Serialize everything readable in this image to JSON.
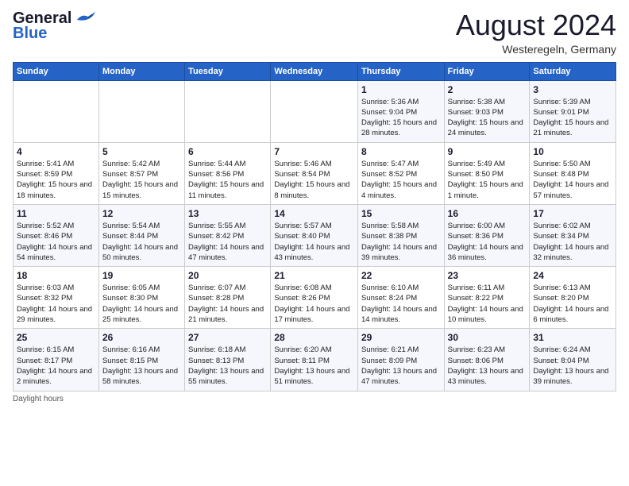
{
  "header": {
    "logo_line1": "General",
    "logo_line2": "Blue",
    "month": "August 2024",
    "location": "Westeregeln, Germany"
  },
  "days_of_week": [
    "Sunday",
    "Monday",
    "Tuesday",
    "Wednesday",
    "Thursday",
    "Friday",
    "Saturday"
  ],
  "weeks": [
    [
      {
        "num": "",
        "sunrise": "",
        "sunset": "",
        "daylight": ""
      },
      {
        "num": "",
        "sunrise": "",
        "sunset": "",
        "daylight": ""
      },
      {
        "num": "",
        "sunrise": "",
        "sunset": "",
        "daylight": ""
      },
      {
        "num": "",
        "sunrise": "",
        "sunset": "",
        "daylight": ""
      },
      {
        "num": "1",
        "sunrise": "Sunrise: 5:36 AM",
        "sunset": "Sunset: 9:04 PM",
        "daylight": "Daylight: 15 hours and 28 minutes."
      },
      {
        "num": "2",
        "sunrise": "Sunrise: 5:38 AM",
        "sunset": "Sunset: 9:03 PM",
        "daylight": "Daylight: 15 hours and 24 minutes."
      },
      {
        "num": "3",
        "sunrise": "Sunrise: 5:39 AM",
        "sunset": "Sunset: 9:01 PM",
        "daylight": "Daylight: 15 hours and 21 minutes."
      }
    ],
    [
      {
        "num": "4",
        "sunrise": "Sunrise: 5:41 AM",
        "sunset": "Sunset: 8:59 PM",
        "daylight": "Daylight: 15 hours and 18 minutes."
      },
      {
        "num": "5",
        "sunrise": "Sunrise: 5:42 AM",
        "sunset": "Sunset: 8:57 PM",
        "daylight": "Daylight: 15 hours and 15 minutes."
      },
      {
        "num": "6",
        "sunrise": "Sunrise: 5:44 AM",
        "sunset": "Sunset: 8:56 PM",
        "daylight": "Daylight: 15 hours and 11 minutes."
      },
      {
        "num": "7",
        "sunrise": "Sunrise: 5:46 AM",
        "sunset": "Sunset: 8:54 PM",
        "daylight": "Daylight: 15 hours and 8 minutes."
      },
      {
        "num": "8",
        "sunrise": "Sunrise: 5:47 AM",
        "sunset": "Sunset: 8:52 PM",
        "daylight": "Daylight: 15 hours and 4 minutes."
      },
      {
        "num": "9",
        "sunrise": "Sunrise: 5:49 AM",
        "sunset": "Sunset: 8:50 PM",
        "daylight": "Daylight: 15 hours and 1 minute."
      },
      {
        "num": "10",
        "sunrise": "Sunrise: 5:50 AM",
        "sunset": "Sunset: 8:48 PM",
        "daylight": "Daylight: 14 hours and 57 minutes."
      }
    ],
    [
      {
        "num": "11",
        "sunrise": "Sunrise: 5:52 AM",
        "sunset": "Sunset: 8:46 PM",
        "daylight": "Daylight: 14 hours and 54 minutes."
      },
      {
        "num": "12",
        "sunrise": "Sunrise: 5:54 AM",
        "sunset": "Sunset: 8:44 PM",
        "daylight": "Daylight: 14 hours and 50 minutes."
      },
      {
        "num": "13",
        "sunrise": "Sunrise: 5:55 AM",
        "sunset": "Sunset: 8:42 PM",
        "daylight": "Daylight: 14 hours and 47 minutes."
      },
      {
        "num": "14",
        "sunrise": "Sunrise: 5:57 AM",
        "sunset": "Sunset: 8:40 PM",
        "daylight": "Daylight: 14 hours and 43 minutes."
      },
      {
        "num": "15",
        "sunrise": "Sunrise: 5:58 AM",
        "sunset": "Sunset: 8:38 PM",
        "daylight": "Daylight: 14 hours and 39 minutes."
      },
      {
        "num": "16",
        "sunrise": "Sunrise: 6:00 AM",
        "sunset": "Sunset: 8:36 PM",
        "daylight": "Daylight: 14 hours and 36 minutes."
      },
      {
        "num": "17",
        "sunrise": "Sunrise: 6:02 AM",
        "sunset": "Sunset: 8:34 PM",
        "daylight": "Daylight: 14 hours and 32 minutes."
      }
    ],
    [
      {
        "num": "18",
        "sunrise": "Sunrise: 6:03 AM",
        "sunset": "Sunset: 8:32 PM",
        "daylight": "Daylight: 14 hours and 29 minutes."
      },
      {
        "num": "19",
        "sunrise": "Sunrise: 6:05 AM",
        "sunset": "Sunset: 8:30 PM",
        "daylight": "Daylight: 14 hours and 25 minutes."
      },
      {
        "num": "20",
        "sunrise": "Sunrise: 6:07 AM",
        "sunset": "Sunset: 8:28 PM",
        "daylight": "Daylight: 14 hours and 21 minutes."
      },
      {
        "num": "21",
        "sunrise": "Sunrise: 6:08 AM",
        "sunset": "Sunset: 8:26 PM",
        "daylight": "Daylight: 14 hours and 17 minutes."
      },
      {
        "num": "22",
        "sunrise": "Sunrise: 6:10 AM",
        "sunset": "Sunset: 8:24 PM",
        "daylight": "Daylight: 14 hours and 14 minutes."
      },
      {
        "num": "23",
        "sunrise": "Sunrise: 6:11 AM",
        "sunset": "Sunset: 8:22 PM",
        "daylight": "Daylight: 14 hours and 10 minutes."
      },
      {
        "num": "24",
        "sunrise": "Sunrise: 6:13 AM",
        "sunset": "Sunset: 8:20 PM",
        "daylight": "Daylight: 14 hours and 6 minutes."
      }
    ],
    [
      {
        "num": "25",
        "sunrise": "Sunrise: 6:15 AM",
        "sunset": "Sunset: 8:17 PM",
        "daylight": "Daylight: 14 hours and 2 minutes."
      },
      {
        "num": "26",
        "sunrise": "Sunrise: 6:16 AM",
        "sunset": "Sunset: 8:15 PM",
        "daylight": "Daylight: 13 hours and 58 minutes."
      },
      {
        "num": "27",
        "sunrise": "Sunrise: 6:18 AM",
        "sunset": "Sunset: 8:13 PM",
        "daylight": "Daylight: 13 hours and 55 minutes."
      },
      {
        "num": "28",
        "sunrise": "Sunrise: 6:20 AM",
        "sunset": "Sunset: 8:11 PM",
        "daylight": "Daylight: 13 hours and 51 minutes."
      },
      {
        "num": "29",
        "sunrise": "Sunrise: 6:21 AM",
        "sunset": "Sunset: 8:09 PM",
        "daylight": "Daylight: 13 hours and 47 minutes."
      },
      {
        "num": "30",
        "sunrise": "Sunrise: 6:23 AM",
        "sunset": "Sunset: 8:06 PM",
        "daylight": "Daylight: 13 hours and 43 minutes."
      },
      {
        "num": "31",
        "sunrise": "Sunrise: 6:24 AM",
        "sunset": "Sunset: 8:04 PM",
        "daylight": "Daylight: 13 hours and 39 minutes."
      }
    ]
  ],
  "footer": "Daylight hours"
}
